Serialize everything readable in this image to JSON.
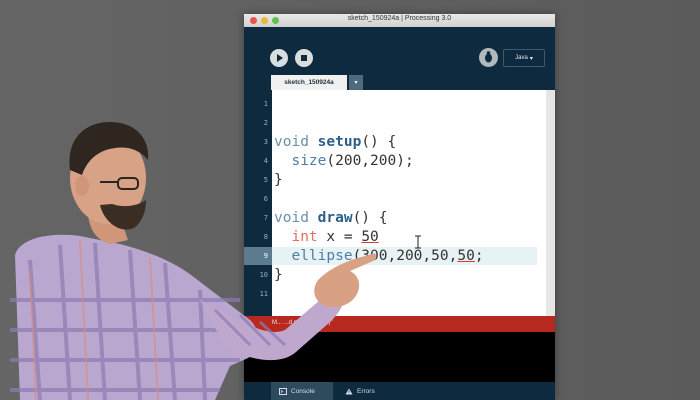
{
  "window": {
    "title": "sketch_150924a | Processing 3.0"
  },
  "toolbar": {
    "mode_label": "Java",
    "mode_arrow": "▾"
  },
  "tabs": {
    "active_tab": "sketch_150924a",
    "dropdown_arrow": "▾"
  },
  "editor": {
    "line_numbers": [
      "1",
      "2",
      "3",
      "4",
      "5",
      "6",
      "7",
      "8",
      "9",
      "10",
      "11"
    ],
    "active_line": 9
  },
  "error_bar": {
    "message": "M... ...d parenthesis \")\""
  },
  "console_tabs": {
    "console_label": "Console",
    "errors_label": "Errors"
  },
  "colors": {
    "window_bg": "#0d2a3f",
    "error_red": "#b7291e",
    "keyword": "#6a8fa9",
    "function_name": "#2b5f8c",
    "type_name": "#e2725b"
  },
  "icons": {
    "run": "play-icon",
    "stop": "stop-icon",
    "debug": "debugger-icon",
    "console": "console-icon",
    "errors": "warning-icon"
  }
}
